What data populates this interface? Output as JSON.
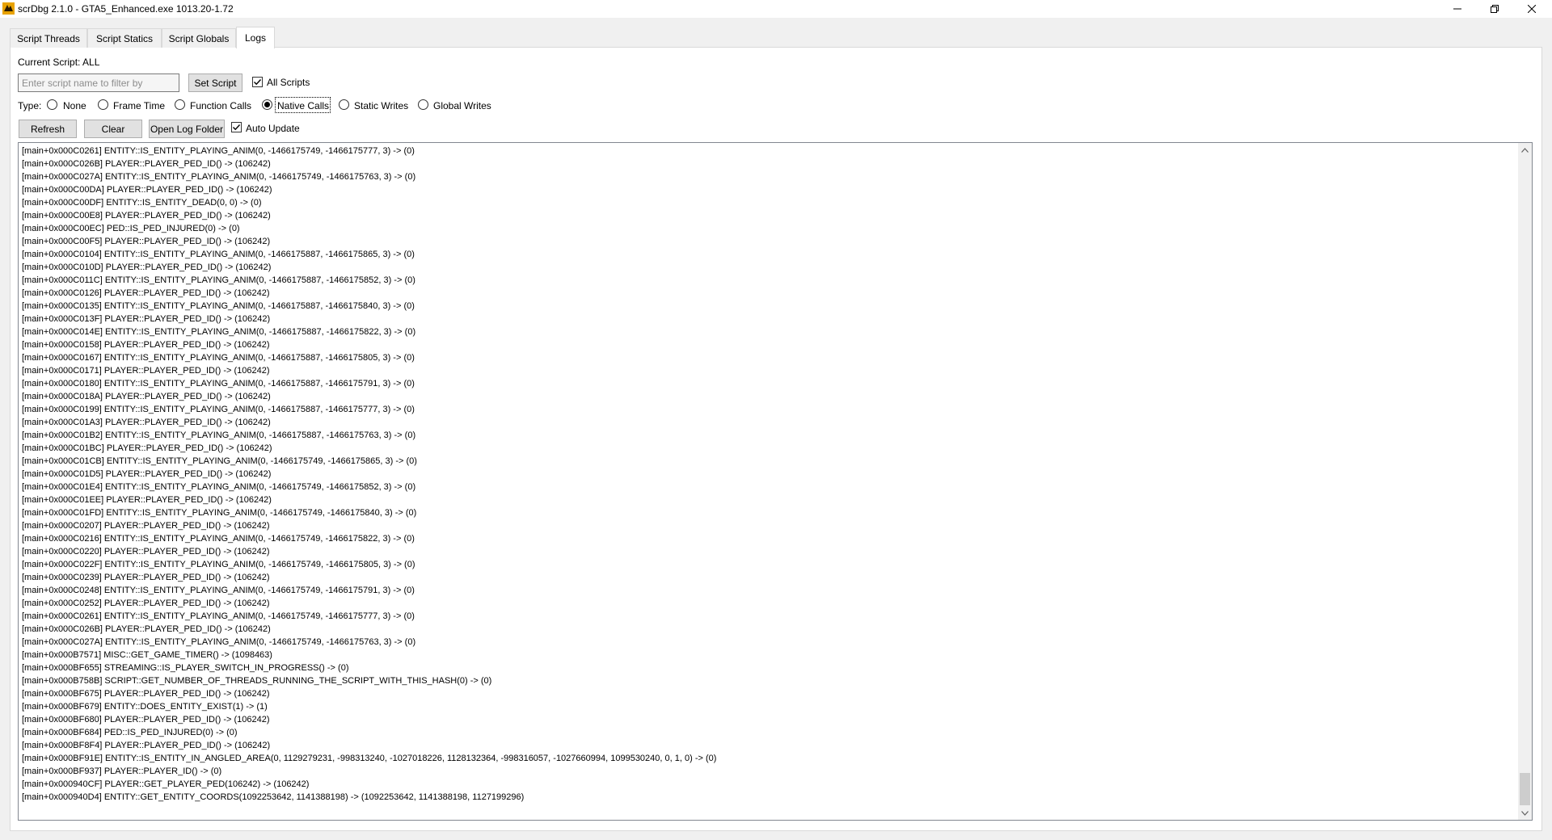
{
  "window": {
    "title": "scrDbg 2.1.0 - GTA5_Enhanced.exe 1013.20-1.72",
    "icon": "app-logo-icon",
    "controls": [
      "minimize-icon",
      "restore-icon",
      "close-icon"
    ]
  },
  "tabs": [
    {
      "label": "Script Threads",
      "active": false
    },
    {
      "label": "Script Statics",
      "active": false
    },
    {
      "label": "Script Globals",
      "active": false
    },
    {
      "label": "Logs",
      "active": true
    }
  ],
  "logs": {
    "current_script_label": "Current Script: ALL",
    "filter_placeholder": "Enter script name to filter by",
    "filter_value": "",
    "set_script_label": "Set Script",
    "all_scripts_label": "All Scripts",
    "all_scripts_checked": true,
    "type_label": "Type:",
    "type_options": [
      {
        "label": "None",
        "selected": false
      },
      {
        "label": "Frame Time",
        "selected": false
      },
      {
        "label": "Function Calls",
        "selected": false
      },
      {
        "label": "Native Calls",
        "selected": true
      },
      {
        "label": "Static Writes",
        "selected": false
      },
      {
        "label": "Global Writes",
        "selected": false
      }
    ],
    "refresh_label": "Refresh",
    "clear_label": "Clear",
    "open_log_folder_label": "Open Log Folder",
    "auto_update_label": "Auto Update",
    "auto_update_checked": true,
    "lines": [
      "[main+0x000C0261] ENTITY::IS_ENTITY_PLAYING_ANIM(0, -1466175749, -1466175777, 3) -> (0)",
      "[main+0x000C026B] PLAYER::PLAYER_PED_ID() -> (106242)",
      "[main+0x000C027A] ENTITY::IS_ENTITY_PLAYING_ANIM(0, -1466175749, -1466175763, 3) -> (0)",
      "[main+0x000C00DA] PLAYER::PLAYER_PED_ID() -> (106242)",
      "[main+0x000C00DF] ENTITY::IS_ENTITY_DEAD(0, 0) -> (0)",
      "[main+0x000C00E8] PLAYER::PLAYER_PED_ID() -> (106242)",
      "[main+0x000C00EC] PED::IS_PED_INJURED(0) -> (0)",
      "[main+0x000C00F5] PLAYER::PLAYER_PED_ID() -> (106242)",
      "[main+0x000C0104] ENTITY::IS_ENTITY_PLAYING_ANIM(0, -1466175887, -1466175865, 3) -> (0)",
      "[main+0x000C010D] PLAYER::PLAYER_PED_ID() -> (106242)",
      "[main+0x000C011C] ENTITY::IS_ENTITY_PLAYING_ANIM(0, -1466175887, -1466175852, 3) -> (0)",
      "[main+0x000C0126] PLAYER::PLAYER_PED_ID() -> (106242)",
      "[main+0x000C0135] ENTITY::IS_ENTITY_PLAYING_ANIM(0, -1466175887, -1466175840, 3) -> (0)",
      "[main+0x000C013F] PLAYER::PLAYER_PED_ID() -> (106242)",
      "[main+0x000C014E] ENTITY::IS_ENTITY_PLAYING_ANIM(0, -1466175887, -1466175822, 3) -> (0)",
      "[main+0x000C0158] PLAYER::PLAYER_PED_ID() -> (106242)",
      "[main+0x000C0167] ENTITY::IS_ENTITY_PLAYING_ANIM(0, -1466175887, -1466175805, 3) -> (0)",
      "[main+0x000C0171] PLAYER::PLAYER_PED_ID() -> (106242)",
      "[main+0x000C0180] ENTITY::IS_ENTITY_PLAYING_ANIM(0, -1466175887, -1466175791, 3) -> (0)",
      "[main+0x000C018A] PLAYER::PLAYER_PED_ID() -> (106242)",
      "[main+0x000C0199] ENTITY::IS_ENTITY_PLAYING_ANIM(0, -1466175887, -1466175777, 3) -> (0)",
      "[main+0x000C01A3] PLAYER::PLAYER_PED_ID() -> (106242)",
      "[main+0x000C01B2] ENTITY::IS_ENTITY_PLAYING_ANIM(0, -1466175887, -1466175763, 3) -> (0)",
      "[main+0x000C01BC] PLAYER::PLAYER_PED_ID() -> (106242)",
      "[main+0x000C01CB] ENTITY::IS_ENTITY_PLAYING_ANIM(0, -1466175749, -1466175865, 3) -> (0)",
      "[main+0x000C01D5] PLAYER::PLAYER_PED_ID() -> (106242)",
      "[main+0x000C01E4] ENTITY::IS_ENTITY_PLAYING_ANIM(0, -1466175749, -1466175852, 3) -> (0)",
      "[main+0x000C01EE] PLAYER::PLAYER_PED_ID() -> (106242)",
      "[main+0x000C01FD] ENTITY::IS_ENTITY_PLAYING_ANIM(0, -1466175749, -1466175840, 3) -> (0)",
      "[main+0x000C0207] PLAYER::PLAYER_PED_ID() -> (106242)",
      "[main+0x000C0216] ENTITY::IS_ENTITY_PLAYING_ANIM(0, -1466175749, -1466175822, 3) -> (0)",
      "[main+0x000C0220] PLAYER::PLAYER_PED_ID() -> (106242)",
      "[main+0x000C022F] ENTITY::IS_ENTITY_PLAYING_ANIM(0, -1466175749, -1466175805, 3) -> (0)",
      "[main+0x000C0239] PLAYER::PLAYER_PED_ID() -> (106242)",
      "[main+0x000C0248] ENTITY::IS_ENTITY_PLAYING_ANIM(0, -1466175749, -1466175791, 3) -> (0)",
      "[main+0x000C0252] PLAYER::PLAYER_PED_ID() -> (106242)",
      "[main+0x000C0261] ENTITY::IS_ENTITY_PLAYING_ANIM(0, -1466175749, -1466175777, 3) -> (0)",
      "[main+0x000C026B] PLAYER::PLAYER_PED_ID() -> (106242)",
      "[main+0x000C027A] ENTITY::IS_ENTITY_PLAYING_ANIM(0, -1466175749, -1466175763, 3) -> (0)",
      "[main+0x000B7571] MISC::GET_GAME_TIMER() -> (1098463)",
      "[main+0x000BF655] STREAMING::IS_PLAYER_SWITCH_IN_PROGRESS() -> (0)",
      "[main+0x000B758B] SCRIPT::GET_NUMBER_OF_THREADS_RUNNING_THE_SCRIPT_WITH_THIS_HASH(0) -> (0)",
      "[main+0x000BF675] PLAYER::PLAYER_PED_ID() -> (106242)",
      "[main+0x000BF679] ENTITY::DOES_ENTITY_EXIST(1) -> (1)",
      "[main+0x000BF680] PLAYER::PLAYER_PED_ID() -> (106242)",
      "[main+0x000BF684] PED::IS_PED_INJURED(0) -> (0)",
      "[main+0x000BF8F4] PLAYER::PLAYER_PED_ID() -> (106242)",
      "[main+0x000BF91E] ENTITY::IS_ENTITY_IN_ANGLED_AREA(0, 1129279231, -998313240, -1027018226, 1128132364, -998316057, -1027660994, 1099530240, 0, 1, 0) -> (0)",
      "[main+0x000BF937] PLAYER::PLAYER_ID() -> (0)",
      "[main+0x000940CF] PLAYER::GET_PLAYER_PED(106242) -> (106242)",
      "[main+0x000940D4] ENTITY::GET_ENTITY_COORDS(1092253642, 1141388198) -> (1092253642, 1141388198, 1127199296)"
    ]
  },
  "colors": {
    "window_bg": "#f0f0f0",
    "panel_bg": "#ffffff",
    "button_bg": "#e1e1e1",
    "focus_accent": "#0078d7"
  }
}
